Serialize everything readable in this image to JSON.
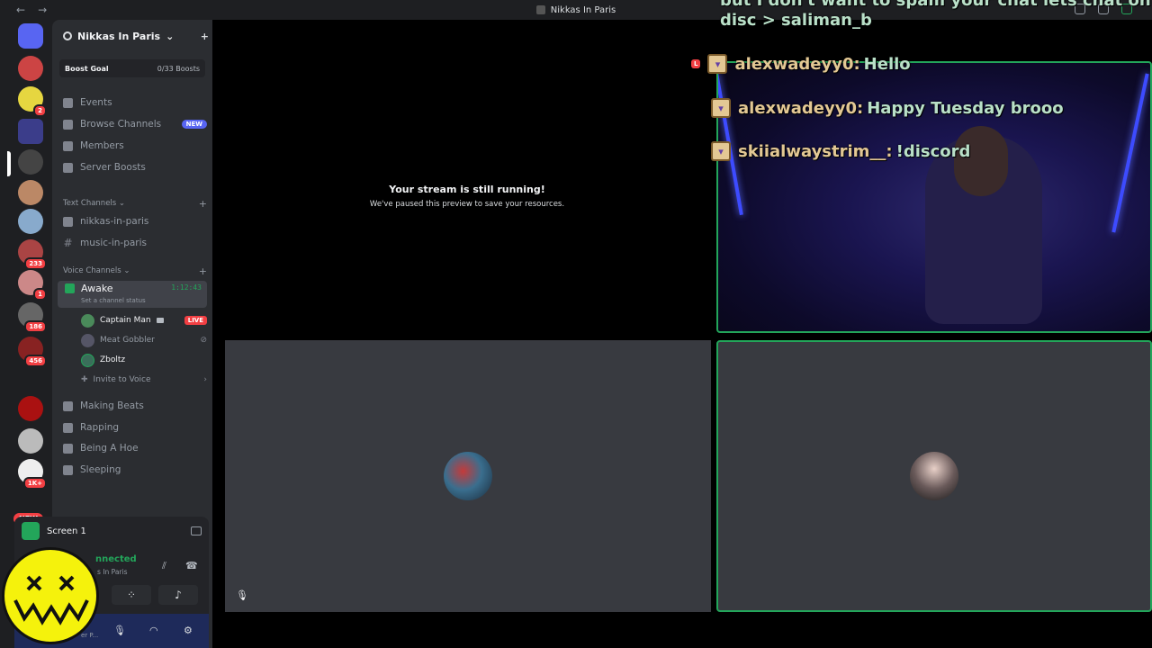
{
  "window": {
    "title": "Nikkas In Paris"
  },
  "server": {
    "name": "Nikkas In Paris"
  },
  "boost": {
    "goal_label": "Boost Goal",
    "count": "0/33 Boosts"
  },
  "nav": [
    {
      "label": "Events"
    },
    {
      "label": "Browse Channels",
      "tag": "NEW"
    },
    {
      "label": "Members"
    },
    {
      "label": "Server Boosts"
    }
  ],
  "text_category": "Text Channels",
  "text_channels": [
    "nikkas-in-paris",
    "music-in-paris"
  ],
  "voice_category": "Voice Channels",
  "active_voice": {
    "name": "Awake",
    "time": "1:12:43",
    "status": "Set a channel status"
  },
  "members": [
    {
      "name": "Captain Man",
      "live": "LIVE"
    },
    {
      "name": "Meat Gobbler"
    },
    {
      "name": "Zboltz"
    },
    {
      "name": "Invite to Voice"
    }
  ],
  "voice_channels": [
    "Making Beats",
    "Rapping",
    "Being A Hoe",
    "Sleeping"
  ],
  "guild_badges": [
    "2",
    "233",
    "1",
    "186",
    "456",
    "1K+"
  ],
  "guild_new": "NEW",
  "panel": {
    "screen": "Screen 1",
    "connected": "nnected",
    "connected_sub": "s In Paris",
    "user_partial": "er P..."
  },
  "stage": {
    "line1": "Your stream is still running!",
    "line2": "We've paused this preview to save your resources."
  },
  "chat": {
    "top1": "but I don't want to spam your chat lets chat on",
    "top2": "disc > saliman_b",
    "lines": [
      {
        "user": "alexwadeyy0:",
        "text": "Hello"
      },
      {
        "user": "alexwadeyy0:",
        "text": "Happy Tuesday brooo"
      },
      {
        "user": "skiialwaystrim__:",
        "text": "!discord"
      }
    ]
  }
}
